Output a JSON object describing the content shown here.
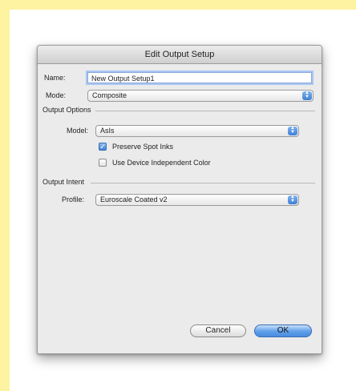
{
  "dialog": {
    "title": "Edit Output Setup",
    "name_label": "Name:",
    "name_value": "New Output Setup1",
    "mode_label": "Mode:",
    "mode_value": "Composite",
    "output_options": {
      "title": "Output Options",
      "model_label": "Model:",
      "model_value": "AsIs",
      "preserve_spot_inks": {
        "label": "Preserve Spot Inks",
        "checked": true
      },
      "use_device_independent_color": {
        "label": "Use Device Independent Color",
        "checked": false
      }
    },
    "output_intent": {
      "title": "Output Intent",
      "profile_label": "Profile:",
      "profile_value": "Euroscale Coated v2"
    },
    "buttons": {
      "cancel": "Cancel",
      "ok": "OK"
    }
  },
  "icons": {
    "popup_arrows": "up-down-arrows-icon",
    "checkmark": "checkmark-icon"
  },
  "colors": {
    "background": "#fdf6b0",
    "accent": "#4a8be0",
    "dialog": "#ebebeb"
  }
}
